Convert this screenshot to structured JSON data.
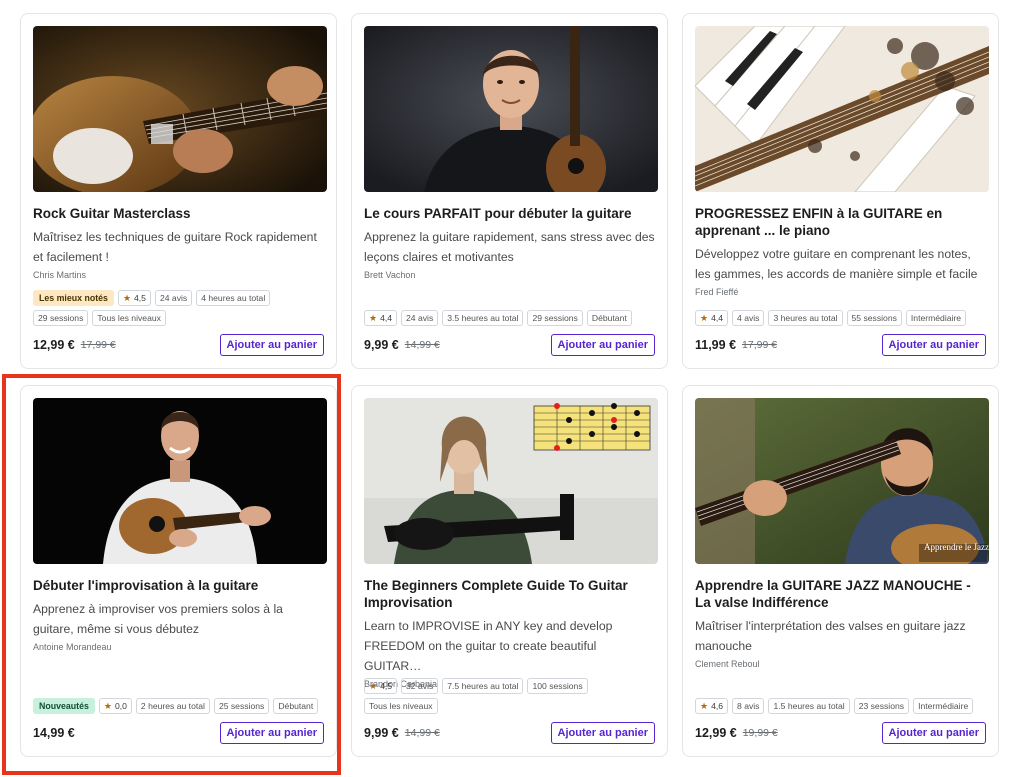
{
  "courses": [
    {
      "title": "Rock Guitar Masterclass",
      "subtitle": "Maîtrisez les techniques de guitare Rock rapidement et facilement !",
      "author": "Chris Martins",
      "badge": "Les mieux notés",
      "rating": "4,5",
      "reviews": "24 avis",
      "hours": "4 heures au total",
      "sessions": "29 sessions",
      "level": "Tous les niveaux",
      "price": "12,99 €",
      "old_price": "17,99 €",
      "cart_label": "Ajouter au panier",
      "thumb_icon": "electric-guitar-closeup-image"
    },
    {
      "title": "Le cours PARFAIT pour débuter la guitare",
      "subtitle": "Apprenez la guitare rapidement, sans stress avec des leçons claires et motivantes",
      "author": "Brett Vachon",
      "rating": "4,4",
      "reviews": "24 avis",
      "hours": "3.5 heures au total",
      "sessions": "29 sessions",
      "level": "Débutant",
      "price": "9,99 €",
      "old_price": "14,99 €",
      "cart_label": "Ajouter au panier",
      "thumb_icon": "instructor-portrait-image"
    },
    {
      "title": "PROGRESSEZ ENFIN à la GUITARE en apprenant ... le piano",
      "subtitle": "Développez votre guitare en comprenant les notes, les gammes, les accords de manière simple et facile",
      "author": "Fred Fieffé",
      "rating": "4,4",
      "reviews": "4 avis",
      "hours": "3 heures au total",
      "sessions": "55 sessions",
      "level": "Intermédiaire",
      "price": "11,99 €",
      "old_price": "17,99 €",
      "cart_label": "Ajouter au panier",
      "thumb_icon": "guitar-piano-art-image"
    },
    {
      "title": "Débuter l'improvisation à la guitare",
      "subtitle": "Apprenez à improviser vos premiers solos à la guitare, même si vous débutez",
      "author": "Antoine Morandeau",
      "badge": "Nouveautés",
      "rating": "0,0",
      "hours": "2 heures au total",
      "sessions": "25 sessions",
      "level": "Débutant",
      "price": "14,99 €",
      "cart_label": "Ajouter au panier",
      "thumb_icon": "acoustic-guitarist-image"
    },
    {
      "title": "The Beginners Complete Guide To Guitar Improvisation",
      "subtitle": "Learn to IMPROVISE in ANY key and develop FREEDOM on the guitar to create beautiful GUITAR…",
      "author": "Brandon Carbenia",
      "rating": "4,5",
      "reviews": "32 avis",
      "hours": "7.5 heures au total",
      "sessions": "100 sessions",
      "level": "Tous les niveaux",
      "price": "9,99 €",
      "old_price": "14,99 €",
      "cart_label": "Ajouter au panier",
      "thumb_icon": "guitarist-with-scale-diagram-image"
    },
    {
      "title": "Apprendre la GUITARE JAZZ MANOUCHE - La valse Indifférence",
      "subtitle": "Maîtriser l'interprétation des valses en guitare jazz manouche",
      "author": "Clement Reboul",
      "rating": "4,6",
      "reviews": "8 avis",
      "hours": "1.5 heures au total",
      "sessions": "23 sessions",
      "level": "Intermédiaire",
      "price": "12,99 €",
      "old_price": "19,99 €",
      "cart_label": "Ajouter au panier",
      "thumb_icon": "jazz-guitarist-image",
      "thumb_watermark": "Apprendre le Jazz Manouche"
    }
  ],
  "colors": {
    "accent": "#5624d0",
    "highlight": "#e8331d",
    "star": "#b4690e",
    "badge_best": "#fce9c3",
    "badge_new": "#c7f0dd"
  }
}
